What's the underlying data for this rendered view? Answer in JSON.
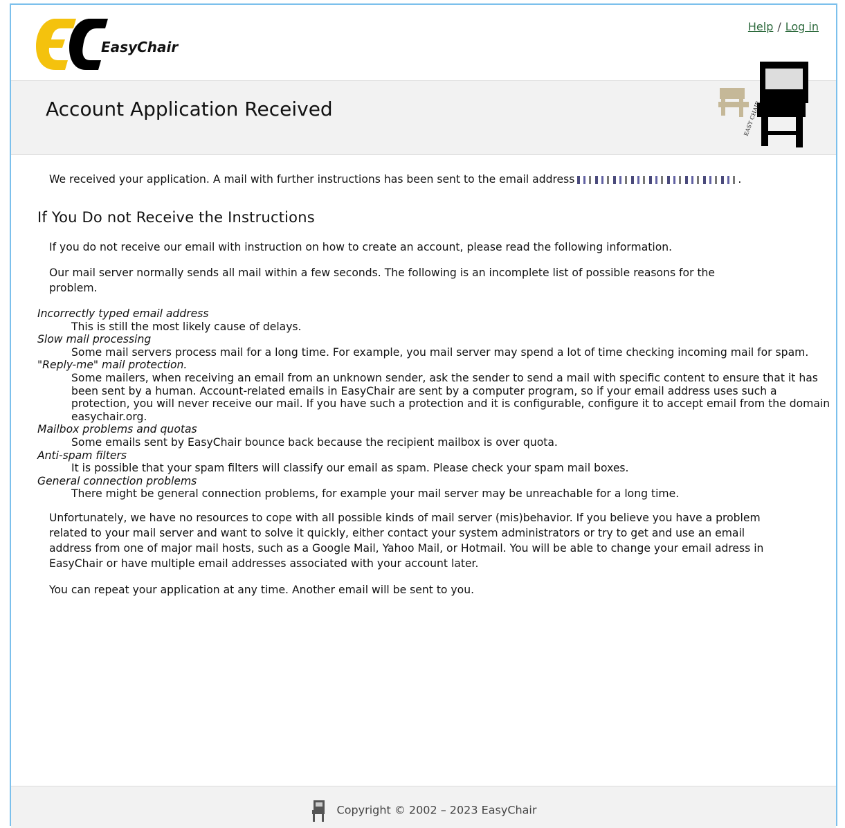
{
  "header": {
    "logo_text": "EasyChair",
    "help_link": "Help",
    "separator": "/",
    "login_link": "Log in"
  },
  "title": "Account Application Received",
  "intro": "We received your application. A mail with further instructions has been sent to the email address",
  "section_heading": "If You Do not Receive the Instructions",
  "para1": "If you do not receive our email with instruction on how to create an account, please read the following information.",
  "para2": "Our mail server normally sends all mail within a few seconds. The following is an incomplete list of possible reasons for the problem.",
  "reasons": [
    {
      "term": "Incorrectly typed email address",
      "desc": "This is still the most likely cause of delays."
    },
    {
      "term": "Slow mail processing",
      "desc": "Some mail servers process mail for a long time. For example, you mail server may spend a lot of time checking incoming mail for spam."
    },
    {
      "term": "\"Reply-me\" mail protection.",
      "desc": "Some mailers, when receiving an email from an unknown sender, ask the sender to send a mail with specific content to ensure that it has been sent by a human. Account-related emails in EasyChair are sent by a computer program, so if your email address uses such a protection, you will never receive our mail. If you have such a protection and it is configurable, configure it to accept email from the domain easychair.org."
    },
    {
      "term": "Mailbox problems and quotas",
      "desc": "Some emails sent by EasyChair bounce back because the recipient mailbox is over quota."
    },
    {
      "term": "Anti-spam filters",
      "desc": "It is possible that your spam filters will classify our email as spam. Please check your spam mail boxes."
    },
    {
      "term": "General connection problems",
      "desc": "There might be general connection problems, for example your mail server may be unreachable for a long time."
    }
  ],
  "para3": "Unfortunately, we have no resources to cope with all possible kinds of mail server (mis)behavior. If you believe you have a problem related to your mail server and want to solve it quickly, either contact your system administrators or try to get and use an email address from one of major mail hosts, such as a Google Mail, Yahoo Mail, or Hotmail. You will be able to change your email adress in EasyChair or have multiple email addresses associated with your account later.",
  "para4": "You can repeat your application at any time. Another email will be sent to you.",
  "footer": {
    "copyright": "Copyright © 2002 – 2023 EasyChair"
  }
}
